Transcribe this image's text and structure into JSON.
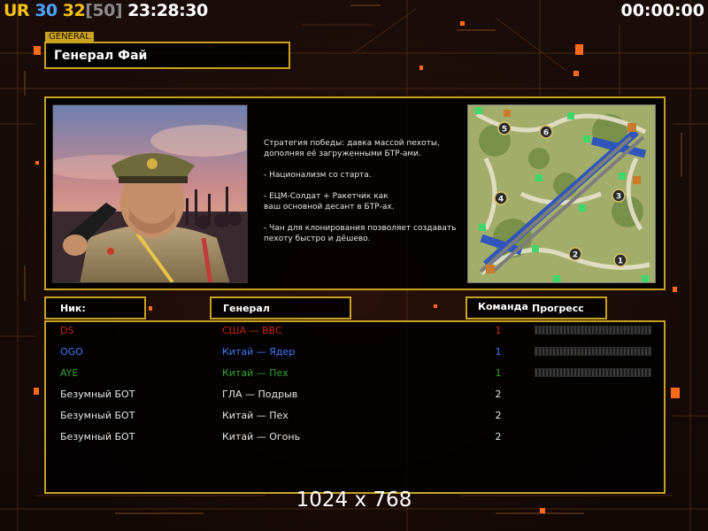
{
  "hud": {
    "fps_prefix": "UR",
    "fps_a": "30",
    "fps_b": "32",
    "fps_cap": "[50]",
    "clock": "23:28:30",
    "timer": "00:00:00"
  },
  "general": {
    "tag": "GENERAL",
    "name": "Генерал Фай",
    "description": "Стратегия победы: давка массой пехоты,\n дополняя её загруженными БТР-ами.\n\n- Национализм со старта.\n\n- ЕЦМ-Солдат + Ракетчик как\nваш основной десант в БТР-ах.\n\n- Чан для клонирования позволяет создавать\n пехоту быстро и дёшево."
  },
  "minimap": {
    "start_positions": [
      "1",
      "2",
      "3",
      "4",
      "5",
      "6"
    ]
  },
  "table": {
    "col_nick": "Ник:",
    "col_general": "Генерал",
    "col_team": "Команда",
    "col_progress": "Прогресс",
    "rows": [
      {
        "nick": "DS",
        "general": "США — ВВС",
        "team": "1",
        "color": "#c8261c",
        "progress": 0
      },
      {
        "nick": "OGO",
        "general": "Китай — Ядер",
        "team": "1",
        "color": "#3b7bff",
        "progress": 0
      },
      {
        "nick": "AYE",
        "general": "Китай — Пех",
        "team": "1",
        "color": "#2fa32f",
        "progress": 0
      },
      {
        "nick": "Безумный БОТ",
        "general": "ГЛА — Подрыв",
        "team": "2",
        "color": "#e6e6e6"
      },
      {
        "nick": "Безумный БОТ",
        "general": "Китай — Пех",
        "team": "2",
        "color": "#e6e6e6"
      },
      {
        "nick": "Безумный БОТ",
        "general": "Китай — Огонь",
        "team": "2",
        "color": "#e6e6e6"
      }
    ]
  },
  "resolution_label": "1024 x 768",
  "colors": {
    "frame": "#c9a21f",
    "hud_yellow": "#f2c316",
    "hud_blue": "#4da3ff"
  }
}
